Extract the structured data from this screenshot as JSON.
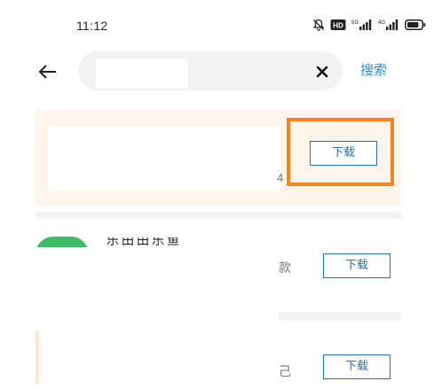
{
  "status_bar": {
    "time": "11:12",
    "icons": [
      "mute-icon",
      "hd-badge-icon",
      "signal-5g-icon",
      "signal-4g-icon",
      "battery-icon"
    ],
    "hd_label": "HD",
    "net1_label": "5G",
    "net2_label": "4G"
  },
  "search": {
    "query": "",
    "search_label": "搜索"
  },
  "results": [
    {
      "fragment": "4",
      "download_label": "下载",
      "highlighted": true
    },
    {
      "title": "乐田田乐鱼",
      "fragment": "款",
      "download_label": "下载"
    },
    {
      "fragment": "己",
      "download_label": "下载"
    }
  ],
  "colors": {
    "accent_blue": "#2a6fb3",
    "search_text_blue": "#2a8fd6",
    "highlight_orange": "#f08624",
    "row_tint": "#fdf5ea",
    "app_icon_green": "#3fba66"
  }
}
